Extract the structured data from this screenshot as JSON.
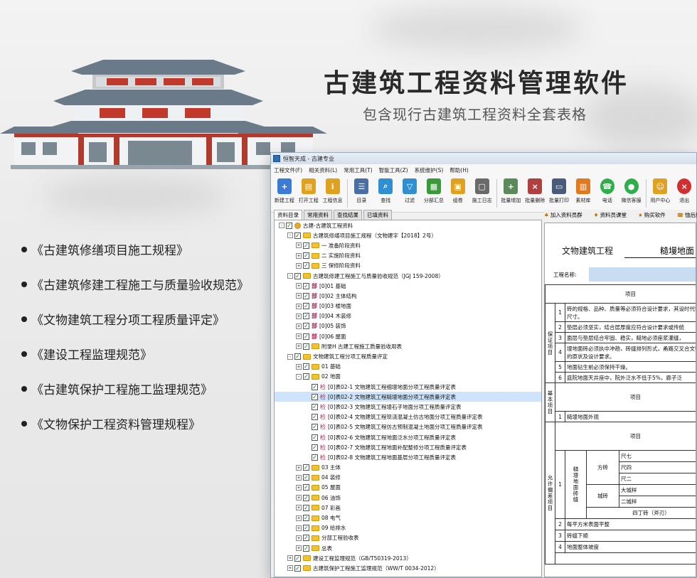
{
  "banner": {
    "headline": "古建筑工程资料管理软件",
    "subline": "包含现行古建筑工程资料全套表格",
    "standards": [
      "《古建筑修缮项目施工规程》",
      "《古建筑修建工程施工与质量验收规范》",
      "《文物建筑工程分项工程质量评定》",
      "《建设工程监理规范》",
      "《古建筑保护工程施工监理规范》",
      "《文物保护工程资料管理规程》"
    ]
  },
  "app": {
    "title": "恒智天成 - 古建专业",
    "menu": [
      "工程文件(F)",
      "相关资料(L)",
      "常用工具(T)",
      "智能工具(Z)",
      "系统维护(S)",
      "帮助(H)"
    ],
    "toolbar": [
      {
        "label": "新建工程",
        "icon": "new-project-icon",
        "color": "#3a7bd5"
      },
      {
        "label": "打开工程",
        "icon": "open-project-icon",
        "color": "#e0a020"
      },
      {
        "label": "工程信息",
        "icon": "project-info-icon",
        "color": "#e0a020"
      },
      {
        "label": "目录",
        "icon": "catalog-icon",
        "color": "#4a6fa5"
      },
      {
        "label": "查找",
        "icon": "find-icon",
        "color": "#2f8fd0"
      },
      {
        "label": "过滤",
        "icon": "filter-icon",
        "color": "#2f8fd0"
      },
      {
        "label": "分部汇总",
        "icon": "summary-icon",
        "color": "#3a9a3a"
      },
      {
        "label": "组卷",
        "icon": "volume-icon",
        "color": "#e0a020"
      },
      {
        "label": "施工日志",
        "icon": "log-icon",
        "color": "#6a6a6a"
      },
      {
        "label": "批量增加",
        "icon": "batch-add-icon",
        "color": "#5a8a5a"
      },
      {
        "label": "批量删除",
        "icon": "batch-delete-icon",
        "color": "#b04040"
      },
      {
        "label": "批量打印",
        "icon": "print-icon",
        "color": "#4a5a7a"
      },
      {
        "label": "素材库",
        "icon": "material-icon",
        "color": "#e07a20"
      },
      {
        "label": "电话",
        "icon": "phone-icon",
        "color": "#2fae4a"
      },
      {
        "label": "微信客服",
        "icon": "wechat-icon",
        "color": "#2fae4a"
      },
      {
        "label": "用户中心",
        "icon": "user-center-icon",
        "color": "#e0a020"
      },
      {
        "label": "退出",
        "icon": "exit-icon",
        "color": "#d03030"
      }
    ],
    "tabs": [
      "资料目录",
      "常用资料",
      "查找结果",
      "已填资料"
    ],
    "tree": [
      {
        "level": 0,
        "exp": "-",
        "icon": "root",
        "label": "古建-古建筑工程资料"
      },
      {
        "level": 1,
        "exp": "-",
        "icon": "folder",
        "label": "古建筑修缮项目施工规程（文物建字【2018】2号）"
      },
      {
        "level": 2,
        "exp": "+",
        "icon": "folder",
        "label": "一  准备阶段资料"
      },
      {
        "level": 2,
        "exp": "+",
        "icon": "folder",
        "label": "二  实施阶段资料"
      },
      {
        "level": 2,
        "exp": "+",
        "icon": "folder",
        "label": "三  保修阶段资料"
      },
      {
        "level": 1,
        "exp": "-",
        "icon": "folder",
        "label": "古建筑修建工程施工与质量验收规范（JGJ 159-2008）"
      },
      {
        "level": 2,
        "exp": "+",
        "icon": "bu",
        "label": "[0]01  基础"
      },
      {
        "level": 2,
        "exp": "+",
        "icon": "bu",
        "label": "[0]02  主体结构"
      },
      {
        "level": 2,
        "exp": "+",
        "icon": "bu",
        "label": "[0]03  楼地面"
      },
      {
        "level": 2,
        "exp": "+",
        "icon": "bu",
        "label": "[0]04  木装修"
      },
      {
        "level": 2,
        "exp": "+",
        "icon": "bu",
        "label": "[0]05  装饰"
      },
      {
        "level": 2,
        "exp": "+",
        "icon": "bu",
        "label": "[0]06  屋面"
      },
      {
        "level": 2,
        "exp": "+",
        "icon": "folder",
        "label": "附录H  古建工程施工质量验收用表"
      },
      {
        "level": 1,
        "exp": "-",
        "icon": "folder",
        "label": "文物建筑工程分项工程质量评定"
      },
      {
        "level": 2,
        "exp": "+",
        "icon": "folder",
        "label": "01  基础"
      },
      {
        "level": 2,
        "exp": "-",
        "icon": "folder",
        "label": "02  地面"
      },
      {
        "level": 3,
        "exp": "",
        "icon": "jian",
        "label": "[0]表02-1  文物建筑工程细墁地面分项工程质量评定表"
      },
      {
        "level": 3,
        "exp": "",
        "icon": "jian",
        "label": "[0]表02-2  文物建筑工程糙墁地面分项工程质量评定表",
        "selected": true
      },
      {
        "level": 3,
        "exp": "",
        "icon": "jian",
        "label": "[0]表02-3  文物建筑工程墁石子地面分项工程质量评定表"
      },
      {
        "level": 3,
        "exp": "",
        "icon": "jian",
        "label": "[0]表02-4  文物建筑工程现浇混凝土仿古地面分项工程质量评定表"
      },
      {
        "level": 3,
        "exp": "",
        "icon": "jian",
        "label": "[0]表02-5  文物建筑工程仿古预制混凝土地面分项工程质量评定表"
      },
      {
        "level": 3,
        "exp": "",
        "icon": "jian",
        "label": "[0]表02-6  文物建筑工程地面泛水分项工程质量评定表"
      },
      {
        "level": 3,
        "exp": "",
        "icon": "jian",
        "label": "[0]表02-7  文物建筑工程地面补配整修分项工程质量评定表"
      },
      {
        "level": 3,
        "exp": "",
        "icon": "jian",
        "label": "[0]表02-8  文物建筑工程地面基层分项工程质量评定表"
      },
      {
        "level": 2,
        "exp": "+",
        "icon": "folder",
        "label": "03  主体"
      },
      {
        "level": 2,
        "exp": "+",
        "icon": "folder",
        "label": "04  装修"
      },
      {
        "level": 2,
        "exp": "+",
        "icon": "folder",
        "label": "05  屋面"
      },
      {
        "level": 2,
        "exp": "+",
        "icon": "folder",
        "label": "06  油饰"
      },
      {
        "level": 2,
        "exp": "+",
        "icon": "folder",
        "label": "07  彩画"
      },
      {
        "level": 2,
        "exp": "+",
        "icon": "folder",
        "label": "08  电气"
      },
      {
        "level": 2,
        "exp": "+",
        "icon": "folder",
        "label": "09  给排水"
      },
      {
        "level": 2,
        "exp": "+",
        "icon": "folder",
        "label": "分部工程验收表"
      },
      {
        "level": 2,
        "exp": "+",
        "icon": "folder",
        "label": "总表"
      },
      {
        "level": 1,
        "exp": "+",
        "icon": "folder",
        "label": "建设工程监理规范（GB/T50319-2013）"
      },
      {
        "level": 1,
        "exp": "+",
        "icon": "folder",
        "label": "古建筑保护工程施工监理规范（WW/T 0034-2012）"
      }
    ],
    "right_toolbar": [
      "加入资料员群",
      "资料员课堂",
      "购买软件",
      "恤后股"
    ],
    "sheet": {
      "title_left": "文物建筑工程",
      "title_right": "糙墁地面",
      "project_label": "工程名称:",
      "header_item": "项目",
      "guarantee_label": "保证项目",
      "guarantee_rows": [
        {
          "no": "1",
          "text": "砖的规格、品种、质量等必须符合设计要求，其设时代特点和尺寸。"
        },
        {
          "no": "2",
          "text": "垫层必须坚实，结合层厚度应符合设计要求或传统"
        },
        {
          "no": "3",
          "text": "面层与垫层结合牢固、稳实，糙地必须座浆灌缝，"
        },
        {
          "no": "4",
          "text": "墁地面砖必须执中冲趟，砖缝排列形式，甬路交叉合文物建筑的原状及设计要求。"
        },
        {
          "no": "5",
          "text": "地面钻生前必须保持干燥。"
        },
        {
          "no": "6",
          "text": "庭院地面天井座中，院外泛水不低于5%，廊子泛"
        }
      ],
      "basic_label": "基本项目",
      "basic_header": "项目",
      "basic_rows": [
        {
          "no": "1",
          "text": "糙墁地面外观"
        }
      ],
      "allow_label": "允许偏差项目",
      "allow_header": "项目",
      "allow_sub": "糙墁地面砖缝",
      "fang_label": "方砖",
      "fang_sizes": [
        "尺七",
        "尺四",
        "尺二"
      ],
      "cheng_label": "城砖",
      "cheng_sizes": [
        "大城样",
        "二城样"
      ],
      "siding": "四丁砖（斧刃）",
      "allow_rows": [
        {
          "no": "2",
          "text": "每平方米表面平整"
        },
        {
          "no": "3",
          "text": "砖缝下顺"
        },
        {
          "no": "4",
          "text": "地面整体坡度"
        }
      ]
    }
  }
}
